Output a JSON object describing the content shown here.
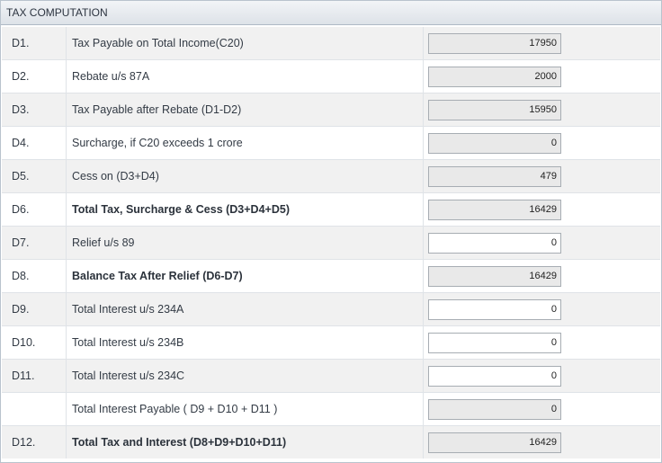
{
  "header": {
    "title": "TAX COMPUTATION"
  },
  "rows": [
    {
      "code": "D1.",
      "label": "Tax Payable on Total Income(C20)",
      "value": "17950",
      "bold": false,
      "editable": false
    },
    {
      "code": "D2.",
      "label": "Rebate u/s 87A",
      "value": "2000",
      "bold": false,
      "editable": false
    },
    {
      "code": "D3.",
      "label": "Tax Payable after Rebate (D1-D2)",
      "value": "15950",
      "bold": false,
      "editable": false
    },
    {
      "code": "D4.",
      "label": "Surcharge, if C20 exceeds 1 crore",
      "value": "0",
      "bold": false,
      "editable": false
    },
    {
      "code": "D5.",
      "label": "Cess on (D3+D4)",
      "value": "479",
      "bold": false,
      "editable": false
    },
    {
      "code": "D6.",
      "label": "Total Tax, Surcharge & Cess (D3+D4+D5)",
      "value": "16429",
      "bold": true,
      "editable": false
    },
    {
      "code": "D7.",
      "label": "Relief u/s 89",
      "value": "0",
      "bold": false,
      "editable": true
    },
    {
      "code": "D8.",
      "label": "Balance Tax After Relief (D6-D7)",
      "value": "16429",
      "bold": true,
      "editable": false
    },
    {
      "code": "D9.",
      "label": "Total Interest u/s 234A",
      "value": "0",
      "bold": false,
      "editable": true
    },
    {
      "code": "D10.",
      "label": "Total Interest u/s 234B",
      "value": "0",
      "bold": false,
      "editable": true
    },
    {
      "code": "D11.",
      "label": "Total Interest u/s 234C",
      "value": "0",
      "bold": false,
      "editable": true
    },
    {
      "code": "",
      "label": "Total Interest Payable ( D9 + D10 + D11 )",
      "value": "0",
      "bold": false,
      "editable": false
    },
    {
      "code": "D12.",
      "label": "Total Tax and Interest (D8+D9+D10+D11)",
      "value": "16429",
      "bold": true,
      "editable": false
    }
  ]
}
